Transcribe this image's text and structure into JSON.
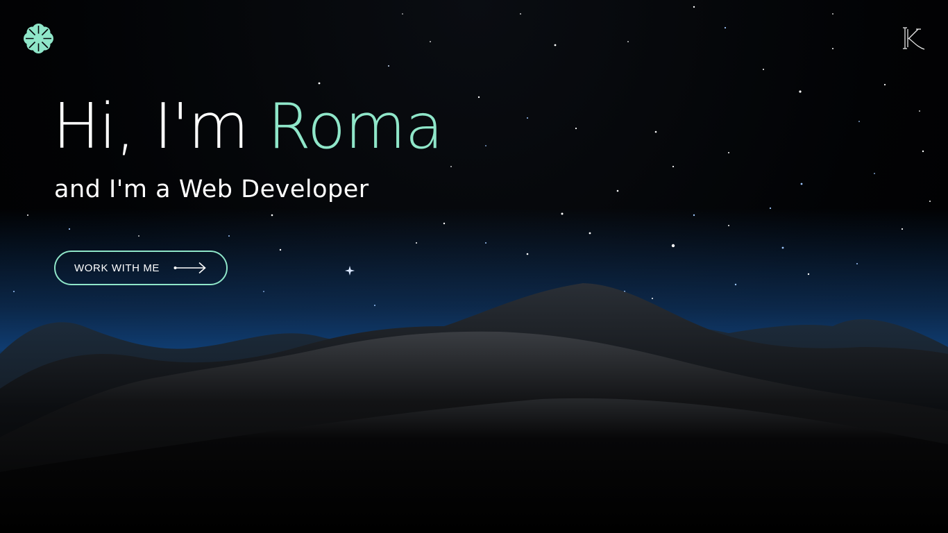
{
  "hero": {
    "greeting": "Hi, I'm ",
    "name": "Roma",
    "subtitle": "and I'm a Web Developer",
    "cta_label": "WORK WITH ME"
  },
  "brand": {
    "logo_icon": "flower-badge-icon",
    "corner_icon": "k-monogram-icon"
  },
  "colors": {
    "accent": "#8fe6c9",
    "text": "#ffffff",
    "background": "#000000",
    "horizon": "#1a5fa0"
  }
}
